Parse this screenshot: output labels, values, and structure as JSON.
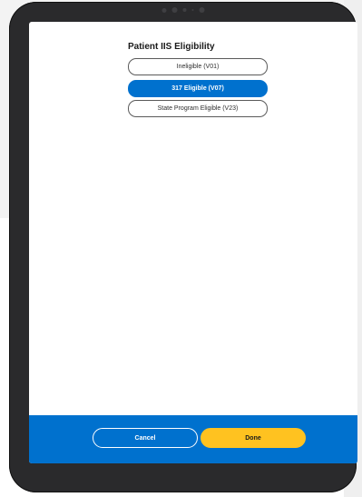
{
  "modal": {
    "title": "Patient IIS Eligibility",
    "options": [
      {
        "label": "Ineligible (V01)",
        "selected": false
      },
      {
        "label": "317 Eligible (V07)",
        "selected": true
      },
      {
        "label": "State Program Eligible (V23)",
        "selected": false
      }
    ]
  },
  "footer": {
    "cancel_label": "Cancel",
    "done_label": "Done"
  },
  "colors": {
    "primary": "#0071ce",
    "accent": "#ffc220",
    "tablet_frame": "#2a2a2c"
  }
}
